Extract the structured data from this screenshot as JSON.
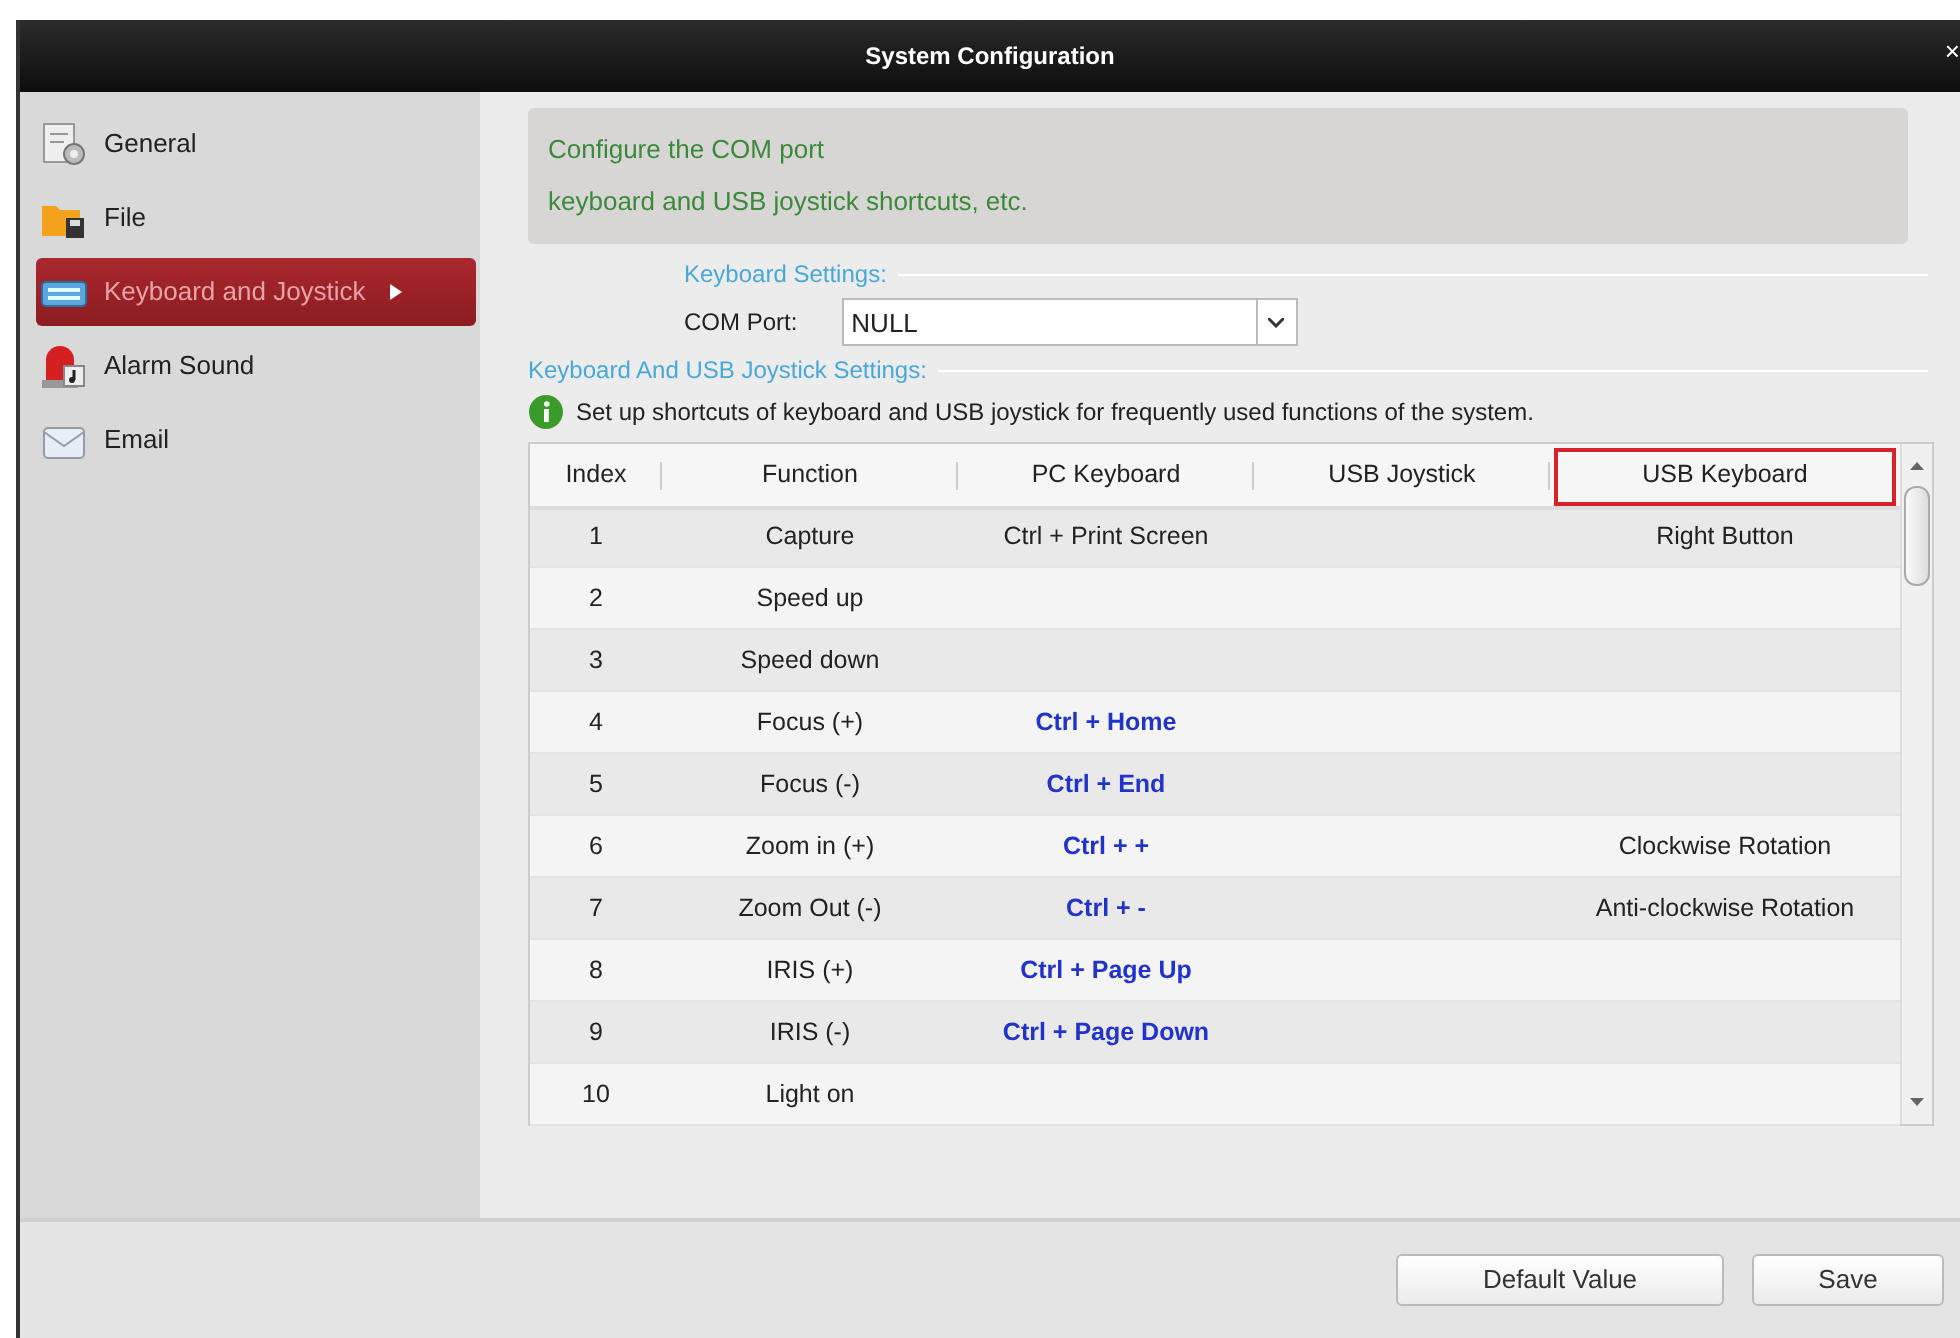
{
  "window": {
    "title": "System Configuration",
    "close": "×"
  },
  "sidebar": {
    "items": [
      {
        "label": "General",
        "selected": false
      },
      {
        "label": "File",
        "selected": false
      },
      {
        "label": "Keyboard and Joystick",
        "selected": true
      },
      {
        "label": "Alarm Sound",
        "selected": false
      },
      {
        "label": "Email",
        "selected": false
      }
    ]
  },
  "description": [
    "Configure the COM port",
    "keyboard and USB joystick shortcuts, etc."
  ],
  "keyboard_settings": {
    "legend": "Keyboard Settings:",
    "com_port": {
      "label": "COM Port:",
      "value": "NULL"
    }
  },
  "shortcut_settings": {
    "legend": "Keyboard And USB Joystick Settings:",
    "hint": "Set up shortcuts of keyboard and USB joystick for frequently used functions of the system."
  },
  "table": {
    "columns": [
      {
        "label": "Index",
        "highlighted": false
      },
      {
        "label": "Function",
        "highlighted": false
      },
      {
        "label": "PC Keyboard",
        "highlighted": false
      },
      {
        "label": "USB Joystick",
        "highlighted": false
      },
      {
        "label": "USB Keyboard",
        "highlighted": true
      }
    ],
    "rows": [
      {
        "index": "1",
        "function": "Capture",
        "pc_keyboard": "Ctrl + Print Screen",
        "pc_emphasized": false,
        "usb_keyboard": "Right Button"
      },
      {
        "index": "2",
        "function": "Speed up"
      },
      {
        "index": "3",
        "function": "Speed down"
      },
      {
        "index": "4",
        "function": "Focus (+)",
        "pc_keyboard": "Ctrl + Home",
        "pc_emphasized": true
      },
      {
        "index": "5",
        "function": "Focus (-)",
        "pc_keyboard": "Ctrl + End",
        "pc_emphasized": true
      },
      {
        "index": "6",
        "function": "Zoom in (+)",
        "pc_keyboard": "Ctrl + +",
        "pc_emphasized": true,
        "usb_keyboard": "Clockwise Rotation"
      },
      {
        "index": "7",
        "function": "Zoom Out (-)",
        "pc_keyboard": "Ctrl + -",
        "pc_emphasized": true,
        "usb_keyboard": "Anti-clockwise Rotation"
      },
      {
        "index": "8",
        "function": "IRIS (+)",
        "pc_keyboard": "Ctrl + Page Up",
        "pc_emphasized": true
      },
      {
        "index": "9",
        "function": "IRIS (-)",
        "pc_keyboard": "Ctrl + Page Down",
        "pc_emphasized": true
      },
      {
        "index": "10",
        "function": "Light on"
      }
    ]
  },
  "buttons": [
    "Default Value",
    "Save"
  ]
}
